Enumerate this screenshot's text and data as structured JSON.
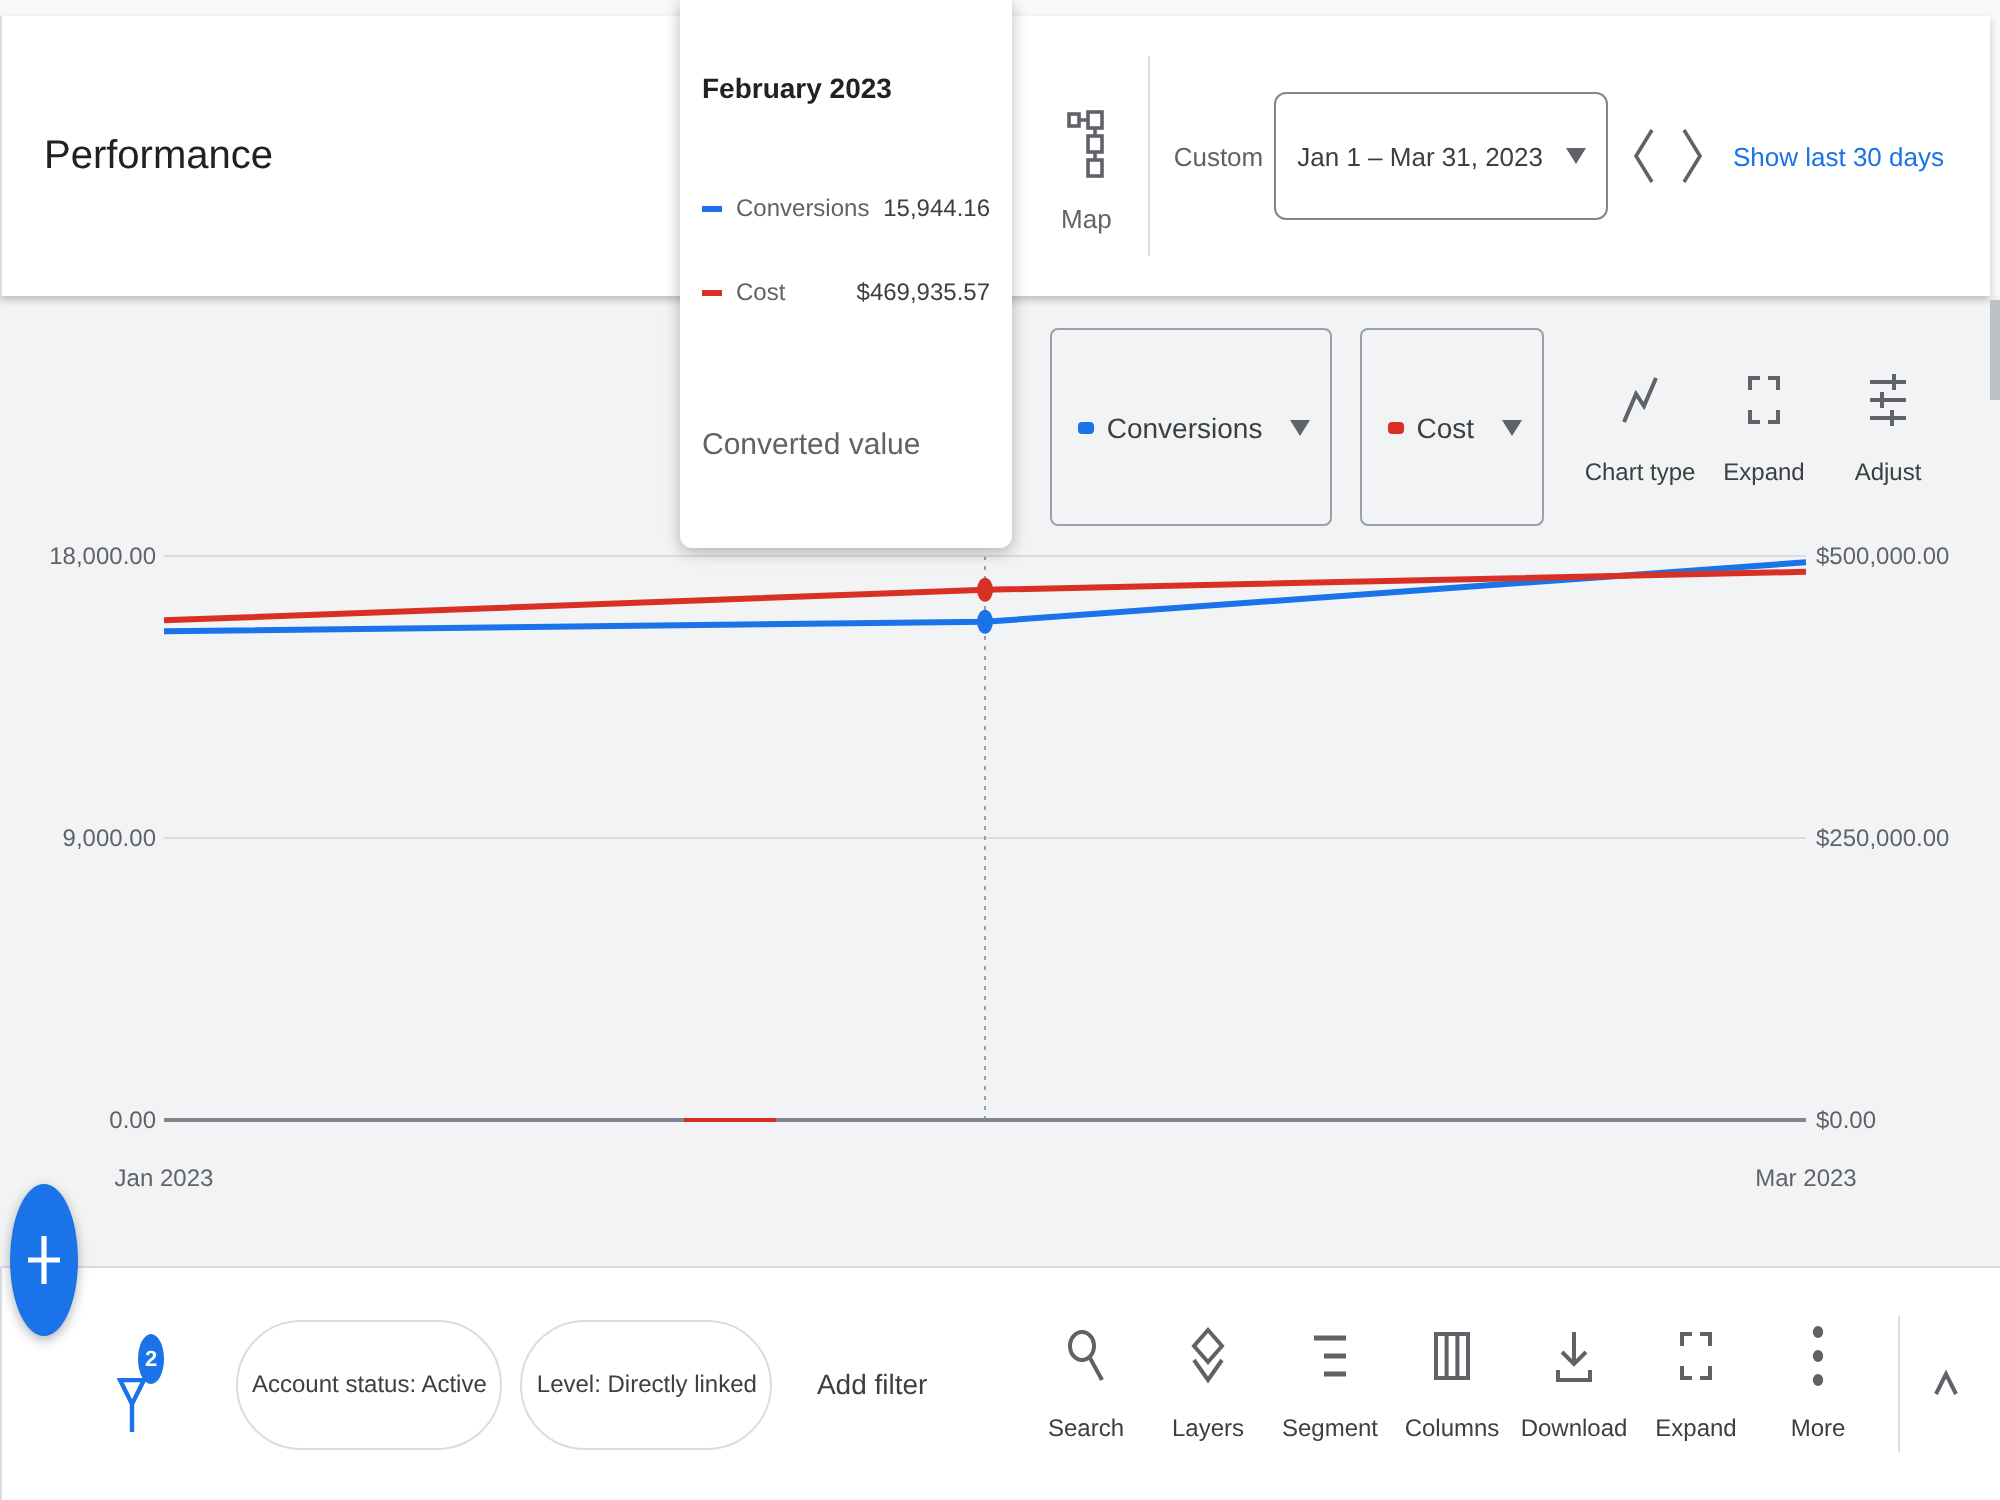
{
  "header": {
    "title": "Performance",
    "map_label": "Map",
    "date_label": "Custom",
    "date_range": "Jan 1 – Mar 31, 2023",
    "quick_link": "Show last 30 days"
  },
  "tooltip": {
    "title": "February 2023",
    "rows": [
      {
        "name": "Conversions",
        "value": "15,944.16",
        "color": "#1a73e8"
      },
      {
        "name": "Cost",
        "value": "$469,935.57",
        "color": "#d93025"
      }
    ],
    "footer": "Converted value"
  },
  "chart": {
    "tools": [
      {
        "kind": "chart-type",
        "label": "Chart type"
      },
      {
        "kind": "expand",
        "label": "Expand"
      },
      {
        "kind": "adjust",
        "label": "Adjust"
      }
    ],
    "chart_data": {
      "type": "line",
      "categories": [
        "Jan 2023",
        null,
        "Mar 2023"
      ],
      "ylim": [
        0,
        18000
      ],
      "yticks": [
        {
          "value": 0,
          "label": "0.00"
        },
        {
          "value": 9000,
          "label": "9,000.00"
        },
        {
          "value": 18000,
          "label": "18,000.00"
        }
      ],
      "y2lim": [
        0,
        500000
      ],
      "y2ticks": [
        {
          "value": 0,
          "label": "$0.00"
        },
        {
          "value": 250000,
          "label": "$250,000.00"
        },
        {
          "value": 500000,
          "label": "$500,000.00"
        }
      ],
      "series": [
        {
          "name": "Conversions",
          "color": "#1a73e8",
          "values": [
            15600,
            15900,
            17800
          ]
        },
        {
          "name": "Cost",
          "color": "#d93025",
          "axis": "y2",
          "values": [
            443000,
            470000,
            486000
          ]
        }
      ]
    }
  },
  "filter_bar": {
    "filter_count": "2",
    "chips": [
      "Account status: Active",
      "Level: Directly linked"
    ],
    "add_filter": "Add filter",
    "tools": [
      {
        "kind": "search",
        "label": "Search"
      },
      {
        "kind": "layers",
        "label": "Layers"
      },
      {
        "kind": "segment",
        "label": "Segment"
      },
      {
        "kind": "columns",
        "label": "Columns"
      },
      {
        "kind": "download",
        "label": "Download"
      },
      {
        "kind": "expand",
        "label": "Expand"
      },
      {
        "kind": "more",
        "label": "More"
      }
    ]
  }
}
